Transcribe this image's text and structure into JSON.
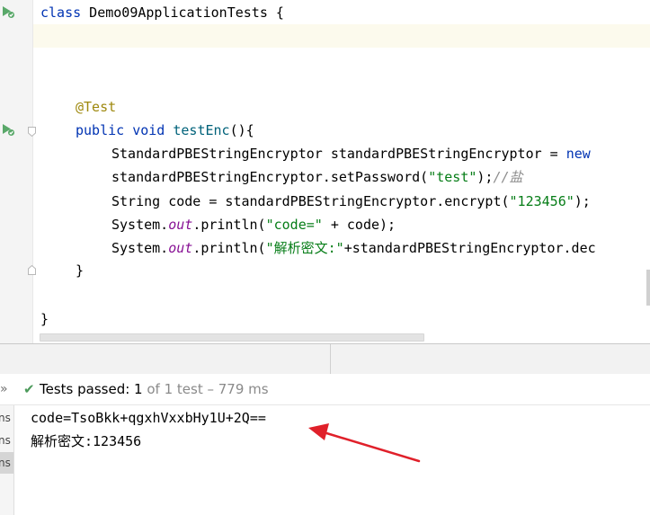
{
  "editor": {
    "lines": {
      "class_kw": "class",
      "class_decl": " Demo09ApplicationTests {",
      "annotation": "@Test",
      "method_public": "public",
      "method_void": " void ",
      "method_name": "testEnc",
      "method_rest": "(){",
      "l1": "StandardPBEStringEncryptor standardPBEStringEncryptor = ",
      "l1_new": "new",
      "l2_a": "standardPBEStringEncryptor.setPassword(",
      "l2_str": "\"test\"",
      "l2_b": ");",
      "l2_cmt": "//盐",
      "l3_a": "String code = standardPBEStringEncryptor.encrypt(",
      "l3_str": "\"123456\"",
      "l3_b": ");",
      "l4_a": "System.",
      "l4_out": "out",
      "l4_b": ".println(",
      "l4_str": "\"code=\"",
      "l4_c": " + code);",
      "l5_a": "System.",
      "l5_out": "out",
      "l5_b": ".println(",
      "l5_str": "\"解析密文:\"",
      "l5_c": "+standardPBEStringEncryptor.dec",
      "close_method": "}",
      "close_class": "}"
    }
  },
  "run_panel": {
    "status": {
      "chevron": "»",
      "check_icon": "check-icon",
      "label": "Tests passed: ",
      "passed": "1",
      "of": " of 1 test",
      "duration": " – 779 ms"
    },
    "test_items": [
      "ns",
      "ns",
      "ns"
    ],
    "console": [
      "code=TsoBkk+qgxhVxxbHy1U+2Q==",
      "解析密文:123456"
    ]
  },
  "colors": {
    "keyword": "#0033b3",
    "annotation": "#9e880d",
    "string": "#067d17",
    "static_field": "#871094",
    "method_name": "#00627a",
    "comment": "#8c8c8c",
    "success": "#4c9a5b",
    "arrow": "#e0202a"
  }
}
